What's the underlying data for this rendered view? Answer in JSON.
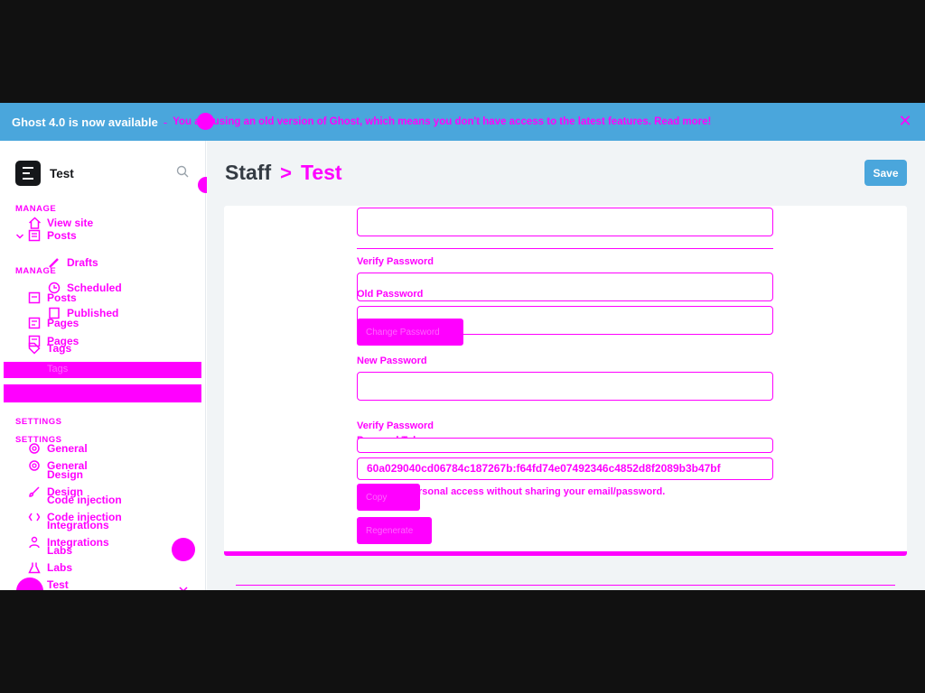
{
  "banner": {
    "title": "Ghost 4.0 is now available",
    "separator": "-",
    "message": "You are using an old version of Ghost, which means you don't have access to the latest features. Read more!"
  },
  "sidebar": {
    "site_name": "Test",
    "manage_heading": "MANAGE",
    "manage_heading_dup": "MANAGE",
    "view_site": "View site",
    "posts": "Posts",
    "drafts": "Drafts",
    "scheduled": "Scheduled",
    "published": "Published",
    "posts_dup": "Posts",
    "pages": "Pages",
    "pages_dup": "Pages",
    "tags": "Tags",
    "tags_dup": "Tags",
    "settings_heading": "SETTINGS",
    "settings_heading_dup": "SETTINGS",
    "general": "General",
    "general_dup": "General",
    "design": "Design",
    "design_dup": "Design",
    "code_injection": "Code injection",
    "code_injection_dup": "Code injection",
    "integrations": "Integrations",
    "integrations_dup": "Integrations",
    "labs": "Labs",
    "labs_dup": "Labs",
    "user": "Test"
  },
  "header": {
    "parent": "Staff",
    "current": "Test",
    "save_label": "Save"
  },
  "form": {
    "verify_password_label": "Verify Password",
    "old_password_label": "Old Password",
    "change_password_button": "Change Password",
    "new_password_label": "New Password",
    "verify_password_label_2": "Verify Password",
    "personal_token_label": "Personal Token",
    "token_value": "60a029040cd06784c187267b:f64fd74e07492346c4852d8f2089b3b47bf",
    "token_help": "rsonal access without sharing your email/password.",
    "copy_button": "Copy",
    "regenerate_button": "Regenerate"
  },
  "colors": {
    "banner": "#4aa6dc",
    "accent": "#ff00ff",
    "save_button": "#4aa6dc"
  }
}
